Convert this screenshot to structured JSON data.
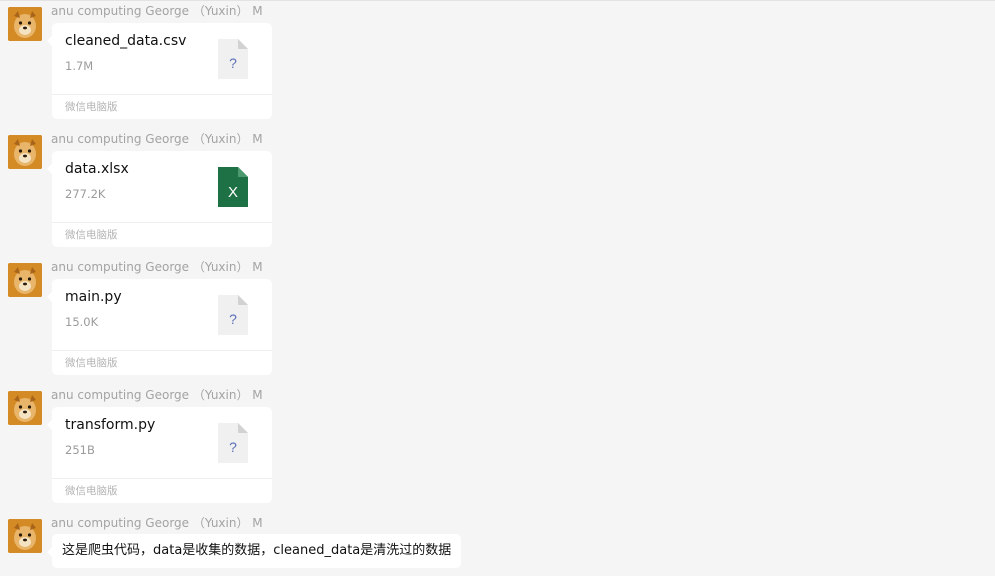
{
  "messages": [
    {
      "type": "file",
      "sender": "anu computing George （Yuxin） M",
      "file_name": "cleaned_data.csv",
      "file_size": "1.7M",
      "file_icon": "unknown-file-icon",
      "icon_glyph": "?",
      "source": "微信电脑版"
    },
    {
      "type": "file",
      "sender": "anu computing George （Yuxin） M",
      "file_name": "data.xlsx",
      "file_size": "277.2K",
      "file_icon": "excel-file-icon",
      "icon_glyph": "X",
      "source": "微信电脑版"
    },
    {
      "type": "file",
      "sender": "anu computing George （Yuxin） M",
      "file_name": "main.py",
      "file_size": "15.0K",
      "file_icon": "unknown-file-icon",
      "icon_glyph": "?",
      "source": "微信电脑版"
    },
    {
      "type": "file",
      "sender": "anu computing George （Yuxin） M",
      "file_name": "transform.py",
      "file_size": "251B",
      "file_icon": "unknown-file-icon",
      "icon_glyph": "?",
      "source": "微信电脑版"
    },
    {
      "type": "text",
      "sender": "anu computing George （Yuxin） M",
      "text": "这是爬虫代码，data是收集的数据，cleaned_data是清洗过的数据"
    }
  ],
  "colors": {
    "background": "#f5f5f5",
    "bubble": "#ffffff",
    "excel_green": "#1e7145",
    "generic_file": "#f0f0f0",
    "question_mark": "#5c6fb8"
  }
}
